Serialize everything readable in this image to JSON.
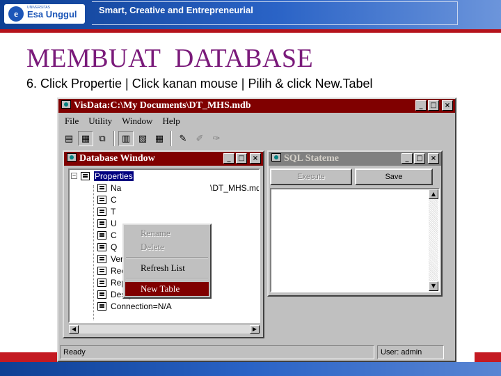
{
  "header": {
    "logo_small": "UNIVERSITAS",
    "logo_name": "Esa Unggul",
    "tagline": "Smart, Creative and Entrepreneurial"
  },
  "slide": {
    "title": "MEMBUAT  DATABASE",
    "subtitle": "6. Click Propertie | Click kanan mouse | Pilih & click New.Tabel"
  },
  "app": {
    "title": "VisData:C:\\My Documents\\DT_MHS.mdb",
    "menu": [
      "File",
      "Utility",
      "Window",
      "Help"
    ],
    "toolbar_icons": [
      "table-icon",
      "dynaset-icon",
      "snapshot-icon",
      "data-control-icon",
      "dbgrid-icon",
      "grid-icon",
      "begin-transaction-icon",
      "commit-icon",
      "rollback-icon"
    ],
    "window_buttons": {
      "minimize": "_",
      "maximize": "□",
      "close": "×"
    }
  },
  "database_window": {
    "title": "Database Window",
    "root_sign": "−",
    "root_label": "Properties",
    "properties": [
      "Na",
      "C",
      "T",
      "U",
      "C",
      "Q",
      "Version=3.0",
      "RecordsAffected=0",
      "ReplicaID=",
      "DesignMasterID=",
      "Connection=N/A"
    ],
    "path_fragment": "\\DT_MHS.md"
  },
  "sql_window": {
    "title": "SQL Stateme",
    "execute_label": "Execute",
    "save_label": "Save",
    "scroll_up": "▲",
    "scroll_down": "▼"
  },
  "context_menu": {
    "items": [
      {
        "label": "Rename",
        "state": "disabled"
      },
      {
        "label": "Delete",
        "state": "disabled"
      },
      {
        "label": "Refresh List",
        "state": "enabled"
      },
      {
        "label": "New Table",
        "state": "selected"
      }
    ]
  },
  "scrollbar": {
    "left": "◀",
    "right": "▶"
  },
  "status": {
    "message": "Ready",
    "user": "User: admin"
  }
}
